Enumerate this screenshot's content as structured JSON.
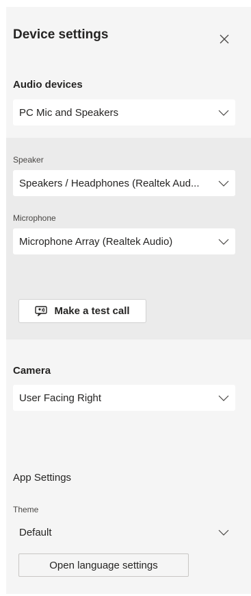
{
  "header": {
    "title": "Device settings",
    "close_icon": "close-icon"
  },
  "audio": {
    "section_label": "Audio devices",
    "selected": "PC Mic and Speakers",
    "speaker_label": "Speaker",
    "speaker_value": "Speakers / Headphones (Realtek Aud...",
    "microphone_label": "Microphone",
    "microphone_value": "Microphone Array (Realtek Audio)",
    "test_call_label": "Make a test call",
    "test_call_icon": "test-call-icon"
  },
  "camera": {
    "section_label": "Camera",
    "selected": "User Facing Right"
  },
  "app_settings": {
    "section_label": "App Settings",
    "theme_label": "Theme",
    "theme_value": "Default",
    "language_button_label": "Open language settings"
  },
  "colors": {
    "panel_bg": "#f5f5f5",
    "device_block_bg": "#ebebeb",
    "dropdown_bg": "#ffffff",
    "text": "#252423"
  }
}
